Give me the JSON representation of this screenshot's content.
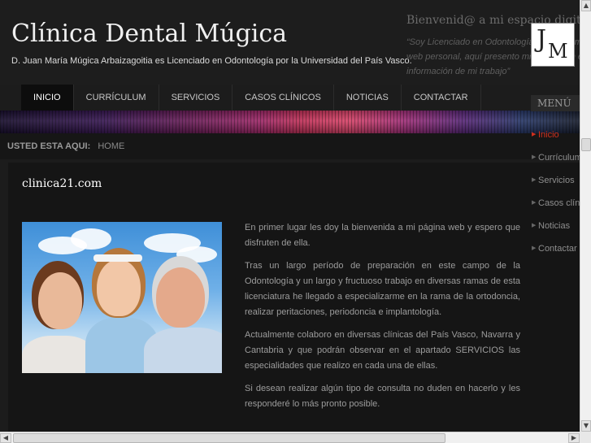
{
  "header": {
    "site_title": "Clínica Dental Múgica",
    "site_description": "D. Juan María Múgica Arbaizagoitia es Licenciado en Odontología por la Universidad del País Vasco.",
    "welcome_title": "Bienvenid@ a mi espacio digital",
    "welcome_quote": "“Soy Licenciado en Odontología y ésta es mi web personal, aquí presento mi currículum e información de mi trabajo”"
  },
  "nav": {
    "items": [
      {
        "label": "INICIO",
        "active": true
      },
      {
        "label": "CURRÍCULUM"
      },
      {
        "label": "SERVICIOS"
      },
      {
        "label": "CASOS CLÍNICOS"
      },
      {
        "label": "NOTICIAS"
      },
      {
        "label": "CONTACTAR"
      }
    ]
  },
  "breadcrumb": {
    "label": "USTED ESTA AQUI:",
    "current": "HOME"
  },
  "article": {
    "title": "clinica21.com",
    "paragraphs": [
      "En primer lugar les doy la bienvenida a mi página web y espero que disfruten de ella.",
      "Tras un largo período de preparación en este campo de la Odontología y un largo y fructuoso trabajo en diversas ramas de esta licenciatura he llegado a especializarme en la rama de la ortodoncia, realizar  peritaciones, periodoncia e implantología.",
      "Actualmente colaboro en diversas clínicas del País Vasco, Navarra y Cantabria y que podrán observar en el apartado SERVICIOS las especialidades que realizo en cada una de ellas.",
      "Si desean realizar algún tipo de consulta no duden en hacerlo y les responderé lo más pronto posible."
    ]
  },
  "sidebar": {
    "logo_letters": [
      "J",
      "M"
    ],
    "menu_title": "MENÚ",
    "items": [
      {
        "label": "Inicio",
        "active": true
      },
      {
        "label": "Currículum"
      },
      {
        "label": "Servicios"
      },
      {
        "label": "Casos clínicos"
      },
      {
        "label": "Noticias"
      },
      {
        "label": "Contactar"
      }
    ]
  },
  "colors": {
    "background": "#1c1c1c",
    "accent_red": "#d0301e",
    "title_white": "#f0f0f0"
  },
  "icons": {
    "bullet": "triangle-right-icon",
    "scroll_up": "arrow-up-icon",
    "scroll_down": "arrow-down-icon",
    "scroll_left": "arrow-left-icon",
    "scroll_right": "arrow-right-icon"
  }
}
